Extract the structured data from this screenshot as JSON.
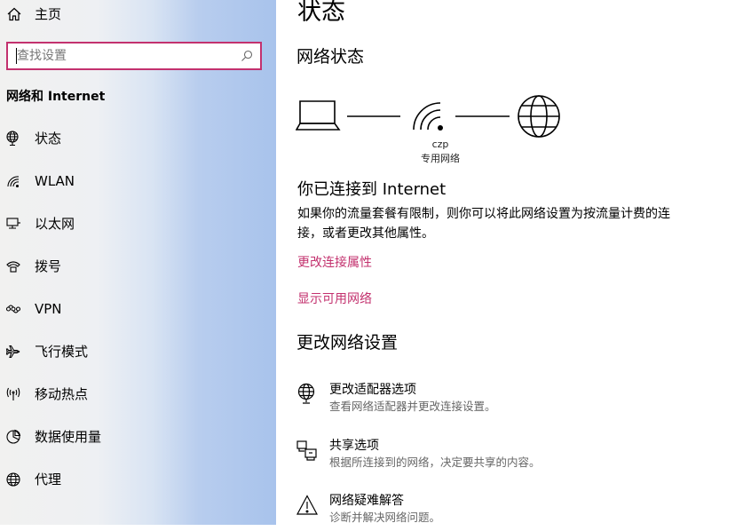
{
  "sidebar": {
    "home_label": "主页",
    "search": {
      "placeholder": "查找设置",
      "value": ""
    },
    "section_title": "网络和 Internet",
    "items": [
      {
        "label": "状态",
        "icon": "globe-status-icon"
      },
      {
        "label": "WLAN",
        "icon": "wifi-icon"
      },
      {
        "label": "以太网",
        "icon": "ethernet-icon"
      },
      {
        "label": "拨号",
        "icon": "dialup-icon"
      },
      {
        "label": "VPN",
        "icon": "vpn-icon"
      },
      {
        "label": "飞行模式",
        "icon": "airplane-icon"
      },
      {
        "label": "移动热点",
        "icon": "hotspot-icon"
      },
      {
        "label": "数据使用量",
        "icon": "data-usage-icon"
      },
      {
        "label": "代理",
        "icon": "proxy-globe-icon"
      }
    ]
  },
  "main": {
    "title": "状态",
    "network_status_heading": "网络状态",
    "network": {
      "name": "czp",
      "type": "专用网络"
    },
    "connection_title": "你已连接到 Internet",
    "connection_desc": "如果你的流量套餐有限制，则你可以将此网络设置为按流量计费的连接，或者更改其他属性。",
    "links": {
      "change_properties": "更改连接属性",
      "show_networks": "显示可用网络"
    },
    "change_settings_heading": "更改网络设置",
    "options": [
      {
        "title": "更改适配器选项",
        "desc": "查看网络适配器并更改连接设置。",
        "icon": "adapter-globe-icon"
      },
      {
        "title": "共享选项",
        "desc": "根据所连接到的网络，决定要共享的内容。",
        "icon": "sharing-icon"
      },
      {
        "title": "网络疑难解答",
        "desc": "诊断并解决网络问题。",
        "icon": "warning-icon"
      }
    ]
  },
  "colors": {
    "accent": "#c3316e",
    "secondary_text": "#666666"
  }
}
